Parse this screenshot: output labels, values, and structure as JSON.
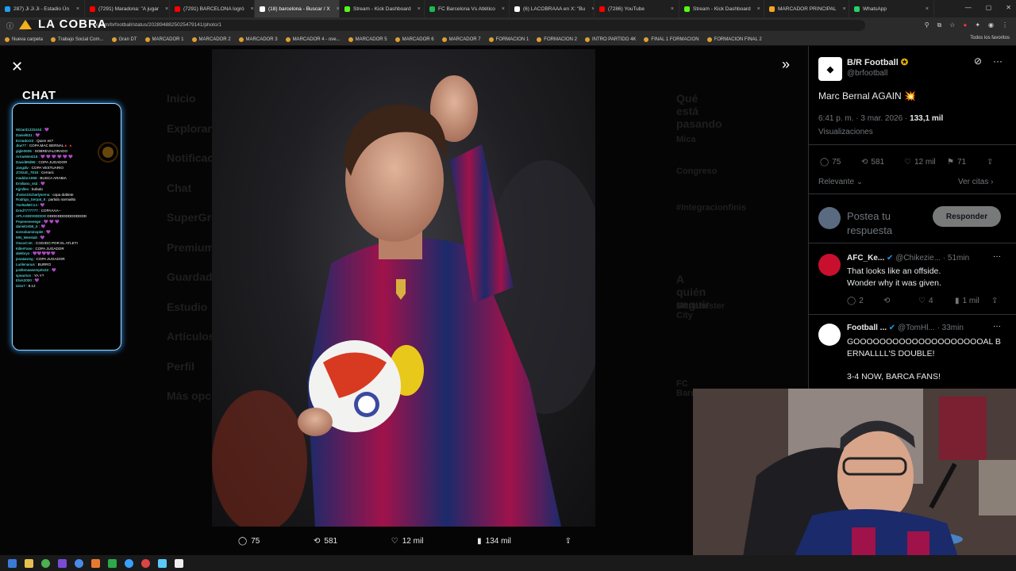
{
  "tabs": [
    {
      "label": "287) Ji Ji Ji - Estadio Ún",
      "color": "#1da1f2"
    },
    {
      "label": "(7291) Maradona: \"A jugar",
      "color": "#ff0000"
    },
    {
      "label": "(7291) BARCELONA logró",
      "color": "#ff0000"
    },
    {
      "label": "(18) barcelona - Buscar / X",
      "color": "#ffffff",
      "active": true
    },
    {
      "label": "Stream - Kick Dashboard",
      "color": "#53fc18"
    },
    {
      "label": "FC Barcelona Vs Atlético",
      "color": "#1db954"
    },
    {
      "label": "(6) LACOBRAAA en X: \"Bu",
      "color": "#ffffff"
    },
    {
      "label": "(7286) YouTube",
      "color": "#ff0000"
    },
    {
      "label": "Stream - Kick Dashboard",
      "color": "#53fc18"
    },
    {
      "label": "MARCADOR PRINCIPAL",
      "color": "#f5a623"
    },
    {
      "label": "WhatsApp",
      "color": "#25d366"
    }
  ],
  "address_url": "x.com/brfootball/status/2028948825025479141/photo/1",
  "bookmarks": [
    "Nueva carpeta",
    "Trabajo Social Com...",
    "Gran DT",
    "MARCADOR 1",
    "MARCADOR 2",
    "MARCADOR 3",
    "MARCADOR 4 - ove...",
    "MARCADOR 5",
    "MARCADOR 6",
    "MARCADOR 7",
    "FORMACION 1",
    "FORMACION 2",
    "INTRO PARTIDO 4K",
    "FINAL 1 FORMACION",
    "FORMACION FINAL 2"
  ],
  "bookmarks_all": "Todos los favoritos",
  "logo_text": "LA COBRA",
  "chat": {
    "title": "CHAT",
    "messages": [
      {
        "user": "Wizard123344d :",
        "text": "💜"
      },
      {
        "user": "Daniel821 :",
        "text": "💜"
      },
      {
        "user": "Ecnador23 :",
        "text": "Quien es?"
      },
      {
        "user": "Jkw77 :",
        "text": "COPA MAC BERNAL🔺🔺"
      },
      {
        "user": "gigle0605 :",
        "text": "SOBREVALORADO"
      },
      {
        "user": "ArrowWest18 :",
        "text": "💜 💜 💜 💜 💜 💜"
      },
      {
        "user": "David99d98 :",
        "text": "COPA JUGADOR"
      },
      {
        "user": "Jangdiv :",
        "text": "COPA VESTUARIO"
      },
      {
        "user": "JOSUE_7918 :",
        "text": "Cerrarú"
      },
      {
        "user": "maddoc1968 :",
        "text": "BUSCA ARABIA"
      },
      {
        "user": "Emiliano_ssd :",
        "text": "💜"
      },
      {
        "user": "Kjjmlleo :",
        "text": "bufado"
      },
      {
        "user": "Jhotos15charlyserna :",
        "text": "copa doblete"
      },
      {
        "user": "Rodrigo_Serpat_8 :",
        "text": "partido normalito"
      },
      {
        "user": "YoelsalMC14 :",
        "text": "💜"
      },
      {
        "user": "Dred7777777 :",
        "text": "COPAAAA--"
      },
      {
        "user": "APLASDDDDDDD",
        "text": "DDDDDDDDDDDDDDD"
      },
      {
        "user": "Pepeeeeeeege :",
        "text": "💜 💜 💜"
      },
      {
        "user": "daniel2456_5 :",
        "text": "💜"
      },
      {
        "user": "sonsokaminoplet :",
        "text": "💜"
      },
      {
        "user": "MN_Messtah :",
        "text": "💜"
      },
      {
        "user": "OscarCnK :",
        "text": "COGIDO POR EL ATLETI"
      },
      {
        "user": "KillerFane :",
        "text": "COPA JUGADOR"
      },
      {
        "user": "alekbryo :",
        "text": "💜💜💜💜💜"
      },
      {
        "user": "jonatanreg :",
        "text": "COPA JUGADOR"
      },
      {
        "user": "Lurilenanus :",
        "text": "BURRO"
      },
      {
        "user": "juniltenaasemp0o32 :",
        "text": "💜"
      },
      {
        "user": "spearrion :",
        "text": "YA Y?"
      },
      {
        "user": "Elvis2000 :",
        "text": "💜"
      },
      {
        "user": "ixiso7 :",
        "text": "9.12"
      }
    ]
  },
  "bg_menu": [
    "Inicio",
    "Explorar",
    "Notificaciones",
    "Chat",
    "SuperGrok",
    "Premium",
    "Guardados",
    "Estudio",
    "Artículos",
    "Perfil",
    "Más opciones"
  ],
  "bg_right": [
    "Qué está pasando",
    "Mica",
    "Congreso",
    "#Integracionfinis",
    "A quién seguir",
    "Manchester City",
    "FC Barcelona"
  ],
  "photo_stats": {
    "replies": "75",
    "reposts": "581",
    "likes": "12 mil",
    "views": "134 mil"
  },
  "tweet": {
    "name": "B/R Football",
    "handle": "@brfootball",
    "text": "Marc Bernal AGAIN 💥",
    "time": "6:41 p. m. · 3 mar. 2026 ·",
    "views_count": "133,1 mil",
    "views_label": "Visualizaciones",
    "replies": "75",
    "reposts": "581",
    "likes": "12 mil",
    "bookmarks": "71",
    "sort_label": "Relevante",
    "quotes_label": "Ver citas",
    "reply_placeholder": "Postea tu respuesta",
    "reply_button": "Responder"
  },
  "replies": [
    {
      "name": "AFC_Ke...",
      "handle": "@Chikezie...",
      "time": "· 51min",
      "text": "That looks like an offside. Wonder why it was given.",
      "replies": "2",
      "reposts": "",
      "likes": "4",
      "views": "1 mil"
    },
    {
      "name": "Football ...",
      "handle": "@TomHl...",
      "time": "· 33min",
      "text_line1": "GOOOOOOOOOOOOOOOOOOOOAL BERNALLLL'S DOUBLE!",
      "text_line2": "3-4 NOW, BARCA FANS!"
    }
  ]
}
